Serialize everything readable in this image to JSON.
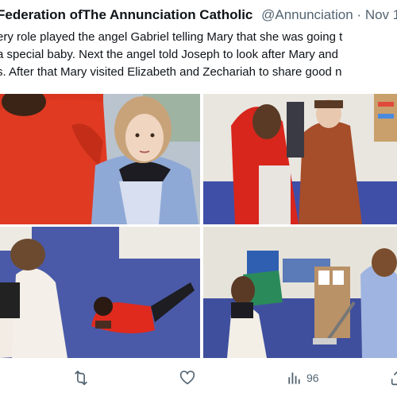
{
  "tweet": {
    "author_name": "Federation ofThe Annunciation Catholic",
    "handle": "@Annunciation",
    "separator": "·",
    "date": "Nov 1",
    "text_lines": [
      "ery role played the angel Gabriel telling Mary that she was going t",
      "a special baby.  Next the angel told Joseph to look after Mary and",
      "s. After that Mary visited Elizabeth and Zechariah to share good n"
    ]
  },
  "media": [
    {
      "label": "photo-children-in-costumes-closeup"
    },
    {
      "label": "photo-mary-and-joseph-costumes"
    },
    {
      "label": "photo-child-lying-on-floor"
    },
    {
      "label": "photo-children-sweeping-classroom"
    }
  ],
  "actions": {
    "retweet_icon": "retweet-icon",
    "like_icon": "heart-icon",
    "views_icon": "views-chart-icon",
    "views_count": "96",
    "share_icon": "share-icon"
  },
  "colors": {
    "text": "#0f1419",
    "secondary": "#536471",
    "background": "#ffffff"
  }
}
